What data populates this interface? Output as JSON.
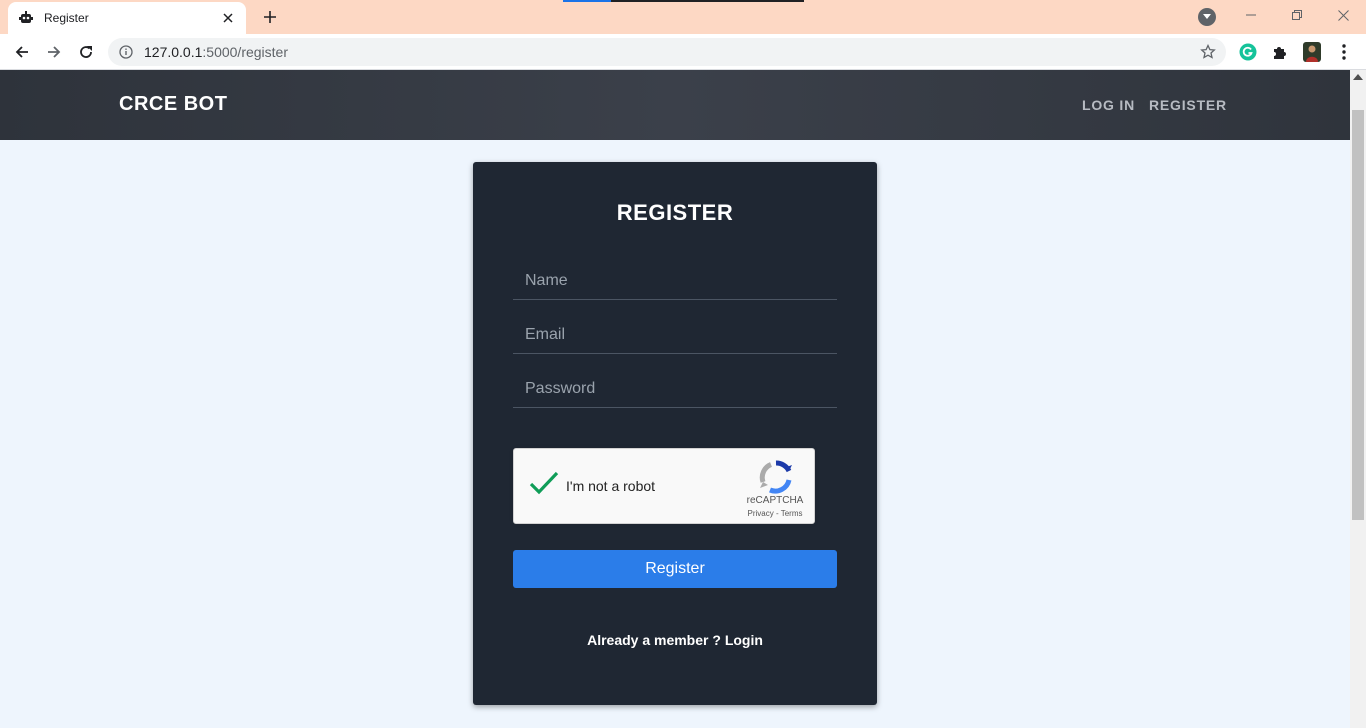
{
  "browser": {
    "tab_title": "Register",
    "url_host": "127.0.0.1",
    "url_path": ":5000/register"
  },
  "site": {
    "brand": "CRCE BOT",
    "nav": {
      "login": "LOG IN",
      "register": "REGISTER"
    }
  },
  "form": {
    "title": "REGISTER",
    "name_placeholder": "Name",
    "email_placeholder": "Email",
    "password_placeholder": "Password",
    "submit_label": "Register"
  },
  "captcha": {
    "label": "I'm not a robot",
    "brand": "reCAPTCHA",
    "links": "Privacy - Terms",
    "checked": true
  },
  "footer": {
    "prompt": "Already a member ?",
    "login_link": "Login"
  },
  "colors": {
    "accent": "#2b7de9",
    "card": "#1f2733",
    "navbar": "#343a43",
    "page": "#eef5fd",
    "check": "#0f9d58"
  }
}
